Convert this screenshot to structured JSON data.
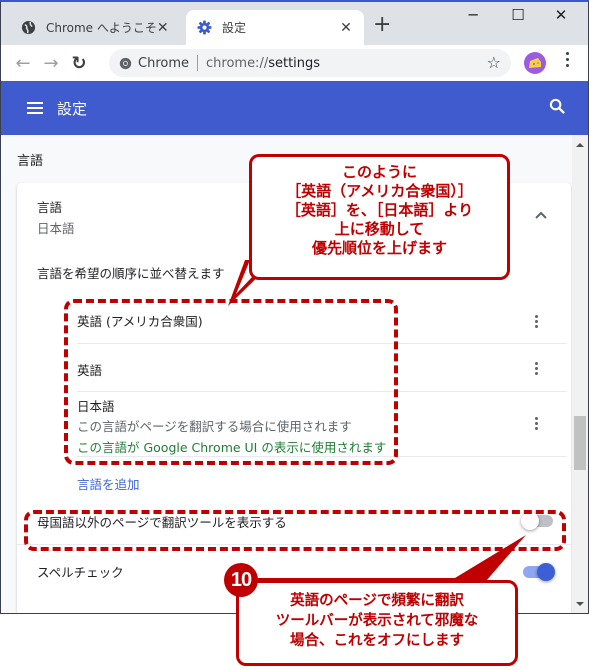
{
  "browser": {
    "tabs": [
      {
        "label": "Chrome へようこそ",
        "icon": "globe-icon",
        "active": false
      },
      {
        "label": "設定",
        "icon": "gear-icon",
        "active": true
      }
    ],
    "new_tab_label": "+",
    "window_controls": {
      "minimize": "─",
      "maximize": "☐",
      "close": "✕"
    },
    "omnibox": {
      "site_label": "Chrome",
      "url_scheme": "chrome://",
      "url_host": "settings"
    }
  },
  "appbar": {
    "title": "設定"
  },
  "section": {
    "title": "言語"
  },
  "languages_card": {
    "header_title": "言語",
    "header_value": "日本語",
    "reorder_label": "言語を希望の順序に並べ替えます",
    "items": [
      {
        "name": "英語 (アメリカ合衆国)",
        "notes": []
      },
      {
        "name": "英語",
        "notes": []
      },
      {
        "name": "日本語",
        "notes": [
          "この言語がページを翻訳する場合に使用されます",
          "この言語が Google Chrome UI の表示に使用されます"
        ]
      }
    ],
    "add_language_label": "言語を追加",
    "translate_offer_label": "母国語以外のページで翻訳ツールを表示する",
    "translate_offer_enabled": false,
    "spellcheck_label": "スペルチェック",
    "spellcheck_enabled": true
  },
  "annotations": {
    "callout_top": [
      "このように",
      "［英語（アメリカ合衆国）］",
      "［英語］を、［日本語］より",
      "上に移動して",
      "優先順位を上げます"
    ],
    "step_number": "10",
    "callout_bottom": [
      "英語のページで頻繁に翻訳",
      "ツールバーが表示されて邪魔な",
      "場合、これをオフにします"
    ],
    "accent_color": "#c00000"
  },
  "colors": {
    "appbar": "#3f5bcd",
    "link": "#3a64d0",
    "toggle_on": "#3d5fd6"
  }
}
